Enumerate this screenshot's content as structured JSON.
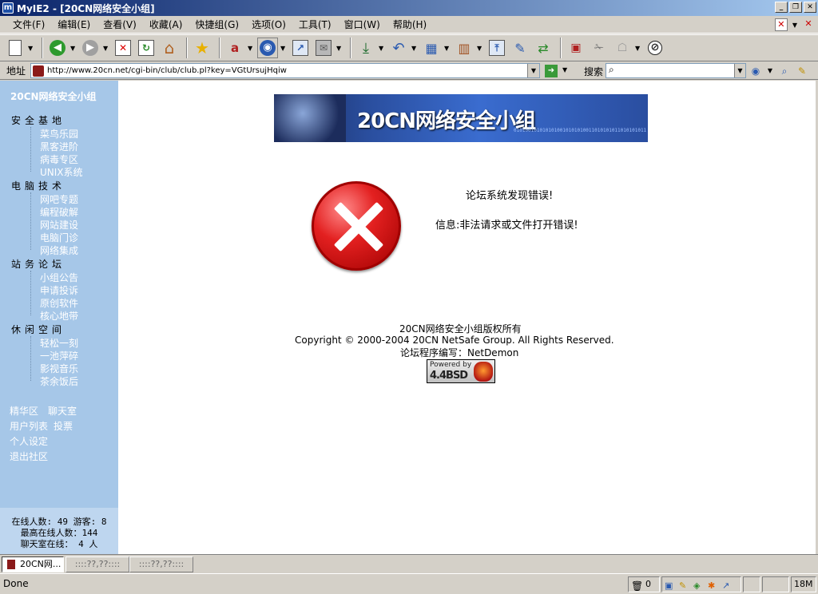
{
  "window": {
    "title": "MyIE2 - [20CN网络安全小组]",
    "app_icon_letter": "m"
  },
  "menu": {
    "items": [
      "文件(F)",
      "编辑(E)",
      "查看(V)",
      "收藏(A)",
      "快捷组(G)",
      "选项(O)",
      "工具(T)",
      "窗口(W)",
      "帮助(H)"
    ]
  },
  "address": {
    "label": "地址",
    "url": "http://www.20cn.net/cgi-bin/club/club.pl?key=VGtUrsujHqiw",
    "search_label": "搜索"
  },
  "sidebar": {
    "title": "20CN网络安全小组",
    "sections": [
      {
        "title": "安全基地",
        "links": [
          "菜鸟乐园",
          "黑客进阶",
          "病毒专区",
          "UNIX系统"
        ]
      },
      {
        "title": "电脑技术",
        "links": [
          "网吧专题",
          "编程破解",
          "网站建设",
          "电脑门诊",
          "网络集成"
        ]
      },
      {
        "title": "站务论坛",
        "links": [
          "小组公告",
          "申请投诉",
          "原创软件",
          "核心地带"
        ]
      },
      {
        "title": "休闲空间",
        "links": [
          "轻松一刻",
          "一池萍碎",
          "影视音乐",
          "茶余饭后"
        ]
      }
    ],
    "bottom_links": [
      "精华区",
      "聊天室",
      "用户列表",
      "投票",
      "个人设定",
      "退出社区"
    ],
    "stats": {
      "line1": "在线人数: 49 游客: 8",
      "line2": "最高在线人数：144",
      "line3": "聊天室在线： 4 人"
    }
  },
  "main": {
    "banner_text": "20CN网络安全小组",
    "banner_binary": "0101001010101010010101010011010101011010101011",
    "error_title": "论坛系统发现错误!",
    "error_info": "信息:非法请求或文件打开错误!",
    "footer_line1": "20CN网络安全小组版权所有",
    "footer_line2": "Copyright © 2000-2004 20CN NetSafe Group. All Rights Reserved.",
    "footer_line3": "论坛程序编写：NetDemon",
    "powered_by": "Powered by",
    "powered_bsd": "4.4BSD"
  },
  "tabs": [
    {
      "label": "20CN网..."
    },
    {
      "label": "::::??,??::::"
    },
    {
      "label": "::::??,??::::"
    }
  ],
  "status": {
    "text": "Done",
    "popup_count": "0",
    "memory": "18M"
  },
  "colors": {
    "sidebar_bg": "#a6c7e8",
    "titlebar_start": "#0a246a",
    "error_red": "#e32020"
  }
}
